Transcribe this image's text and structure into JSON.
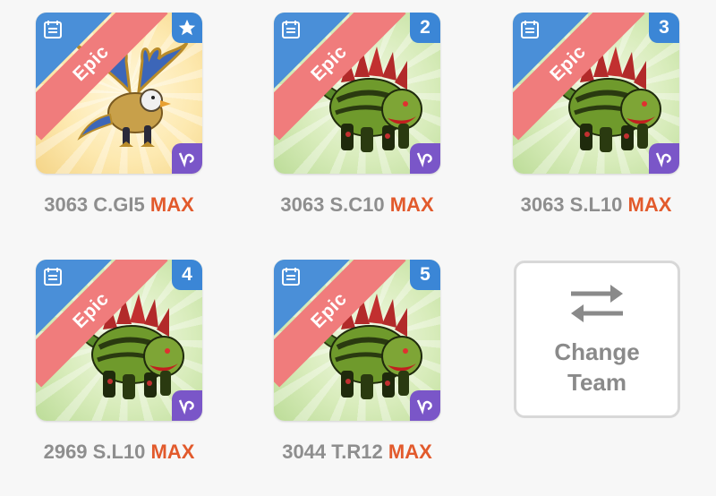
{
  "team": {
    "slots": [
      {
        "rarity": "Epic",
        "badge": "",
        "badge_icon": "star-icon",
        "level": "3063",
        "name": "C.GI5",
        "status": "MAX",
        "monster": "griffin",
        "background": "gold"
      },
      {
        "rarity": "Epic",
        "badge": "2",
        "level": "3063",
        "name": "S.C10",
        "status": "MAX",
        "monster": "spiked-beast",
        "background": "green"
      },
      {
        "rarity": "Epic",
        "badge": "3",
        "level": "3063",
        "name": "S.L10",
        "status": "MAX",
        "monster": "spiked-beast",
        "background": "green"
      },
      {
        "rarity": "Epic",
        "badge": "4",
        "level": "2969",
        "name": "S.L10",
        "status": "MAX",
        "monster": "spiked-beast",
        "background": "green"
      },
      {
        "rarity": "Epic",
        "badge": "5",
        "level": "3044",
        "name": "T.R12",
        "status": "MAX",
        "monster": "spiked-beast",
        "background": "green"
      }
    ],
    "change_team": {
      "label_line1": "Change",
      "label_line2": "Team",
      "icon": "swap-arrows-icon"
    }
  },
  "colors": {
    "epic_ribbon": "#f07c7c",
    "corner_blue": "#3b86d6",
    "class_purple": "#7a56c8",
    "max_orange": "#e25a2c",
    "caption_gray": "#8e8e8e"
  }
}
